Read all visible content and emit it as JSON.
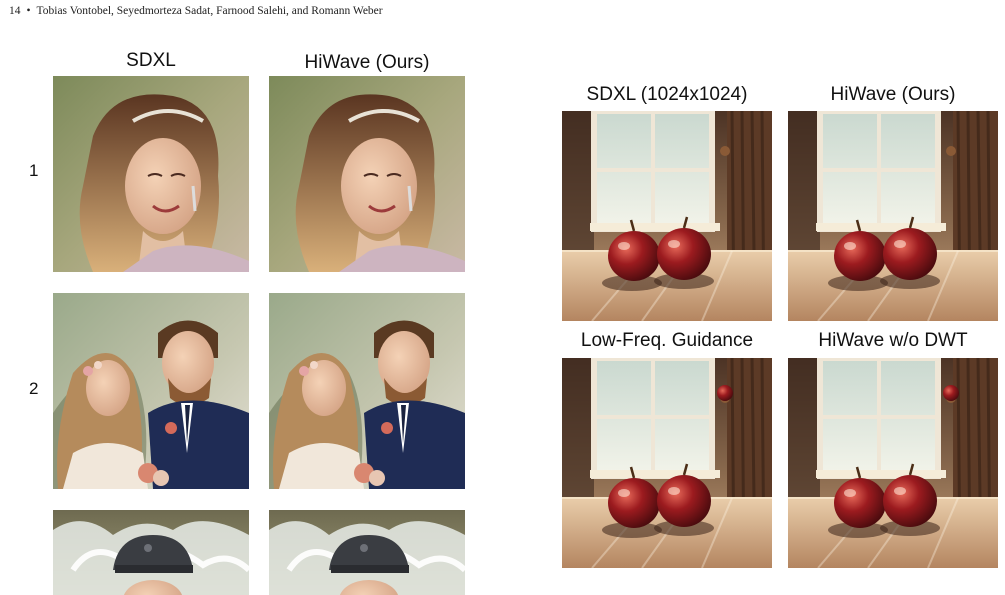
{
  "header": {
    "page_number": "14",
    "separator": "•",
    "authors": "Tobias Vontobel, Seyedmorteza Sadat, Farnood Salehi, and Romann Weber"
  },
  "left_figure": {
    "columns": [
      "SDXL",
      "HiWave (Ours)"
    ],
    "rows": [
      "1",
      "2"
    ]
  },
  "right_figure": {
    "labels": [
      "SDXL (1024x1024)",
      "HiWave (Ours)",
      "Low-Freq. Guidance",
      "HiWave w/o DWT"
    ]
  }
}
